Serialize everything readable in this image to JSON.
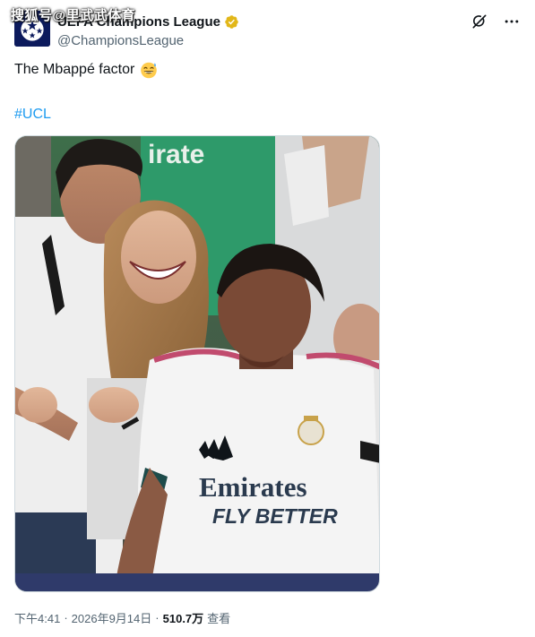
{
  "watermark": "搜狐号@里武武体育",
  "account": {
    "display_name": "UEFA Champions League",
    "handle": "@ChampionsLeague",
    "verified_badge": "gold-verified-icon",
    "avatar": "ucl-starball-logo"
  },
  "header_icons": {
    "grok": "grok-icon",
    "more": "more-horizontal-icon"
  },
  "tweet": {
    "text": "The Mbappé factor",
    "emoji": "grinning-sweat-emoji",
    "hashtag": "#UCL"
  },
  "media": {
    "jersey_sponsor_line1": "Emirates",
    "jersey_sponsor_line2": "FLY BETTER",
    "background_banner_text": "irate"
  },
  "meta": {
    "time": "下午4:41",
    "separator": "·",
    "date": "2026年9月14日",
    "views": "510.7万",
    "views_label": "查看"
  },
  "colors": {
    "link": "#1d9bf0",
    "secondary_text": "#536471",
    "gold_badge": "#e2b719",
    "avatar_bg": "#0c1a5c"
  }
}
